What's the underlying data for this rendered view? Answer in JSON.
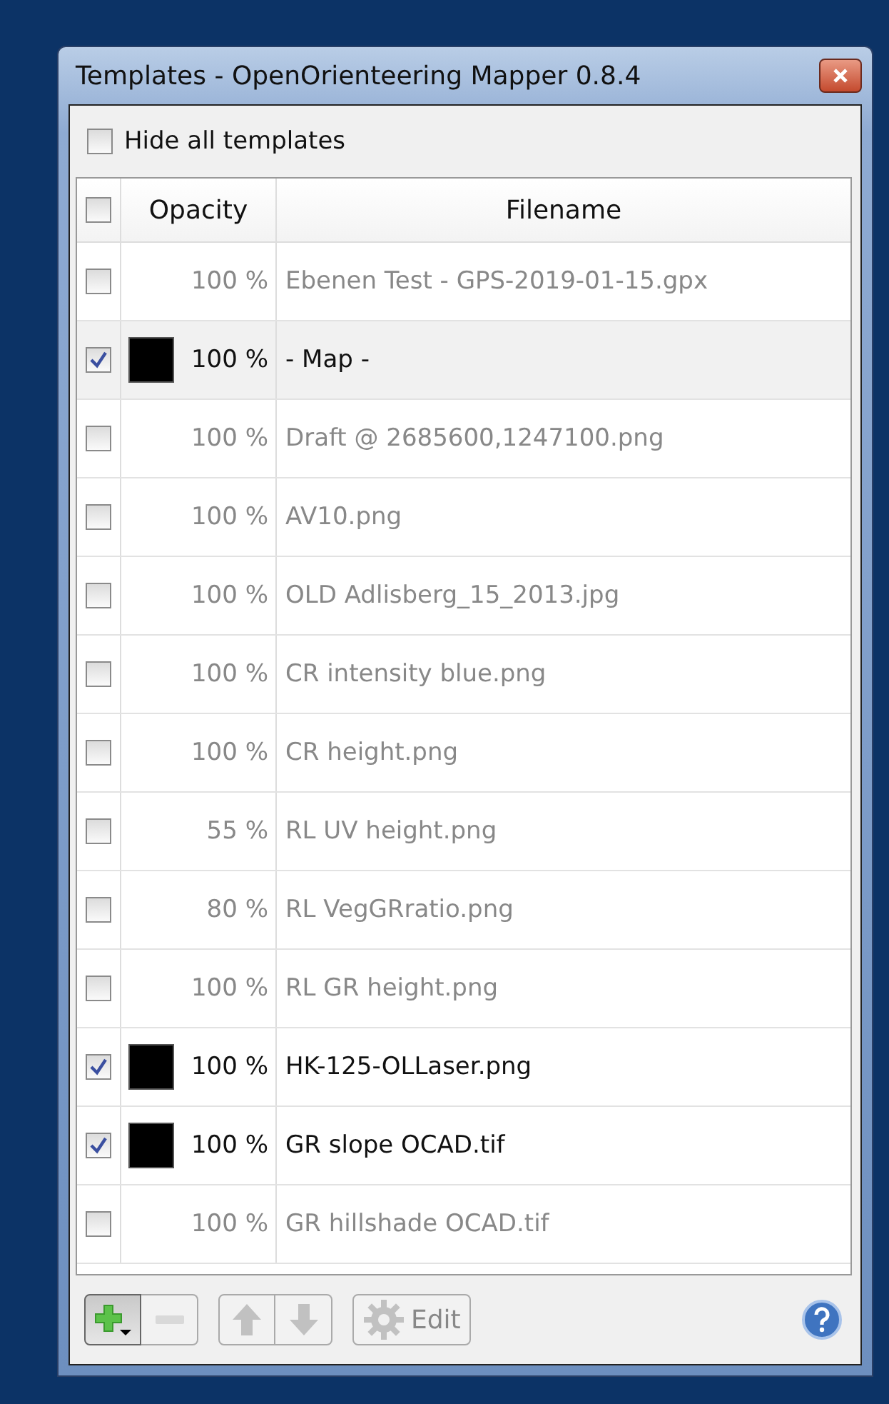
{
  "window": {
    "title": "Templates - OpenOrienteering Mapper 0.8.4"
  },
  "hide_all": {
    "label": "Hide all templates",
    "checked": false
  },
  "table": {
    "header_checked": false,
    "columns": [
      "Opacity",
      "Filename"
    ],
    "rows": [
      {
        "checked": false,
        "selected": false,
        "opacity": "100 %",
        "filename": "Ebenen Test - GPS-2019-01-15.gpx"
      },
      {
        "checked": true,
        "selected": true,
        "opacity": "100 %",
        "filename": "- Map -"
      },
      {
        "checked": false,
        "selected": false,
        "opacity": "100 %",
        "filename": "Draft @ 2685600,1247100.png"
      },
      {
        "checked": false,
        "selected": false,
        "opacity": "100 %",
        "filename": "AV10.png"
      },
      {
        "checked": false,
        "selected": false,
        "opacity": "100 %",
        "filename": "OLD Adlisberg_15_2013.jpg"
      },
      {
        "checked": false,
        "selected": false,
        "opacity": "100 %",
        "filename": "CR intensity blue.png"
      },
      {
        "checked": false,
        "selected": false,
        "opacity": "100 %",
        "filename": "CR height.png"
      },
      {
        "checked": false,
        "selected": false,
        "opacity": "55 %",
        "filename": "RL UV height.png"
      },
      {
        "checked": false,
        "selected": false,
        "opacity": "80 %",
        "filename": "RL VegGRratio.png"
      },
      {
        "checked": false,
        "selected": false,
        "opacity": "100 %",
        "filename": "RL GR height.png"
      },
      {
        "checked": true,
        "selected": false,
        "opacity": "100 %",
        "filename": "HK-125-OLLaser.png"
      },
      {
        "checked": true,
        "selected": false,
        "opacity": "100 %",
        "filename": "GR slope OCAD.tif"
      },
      {
        "checked": false,
        "selected": false,
        "opacity": "100 %",
        "filename": "GR hillshade OCAD.tif"
      }
    ]
  },
  "toolbar": {
    "add_disabled": false,
    "remove_disabled": true,
    "up_disabled": true,
    "down_disabled": true,
    "edit": {
      "label": "Edit",
      "disabled": true
    }
  }
}
